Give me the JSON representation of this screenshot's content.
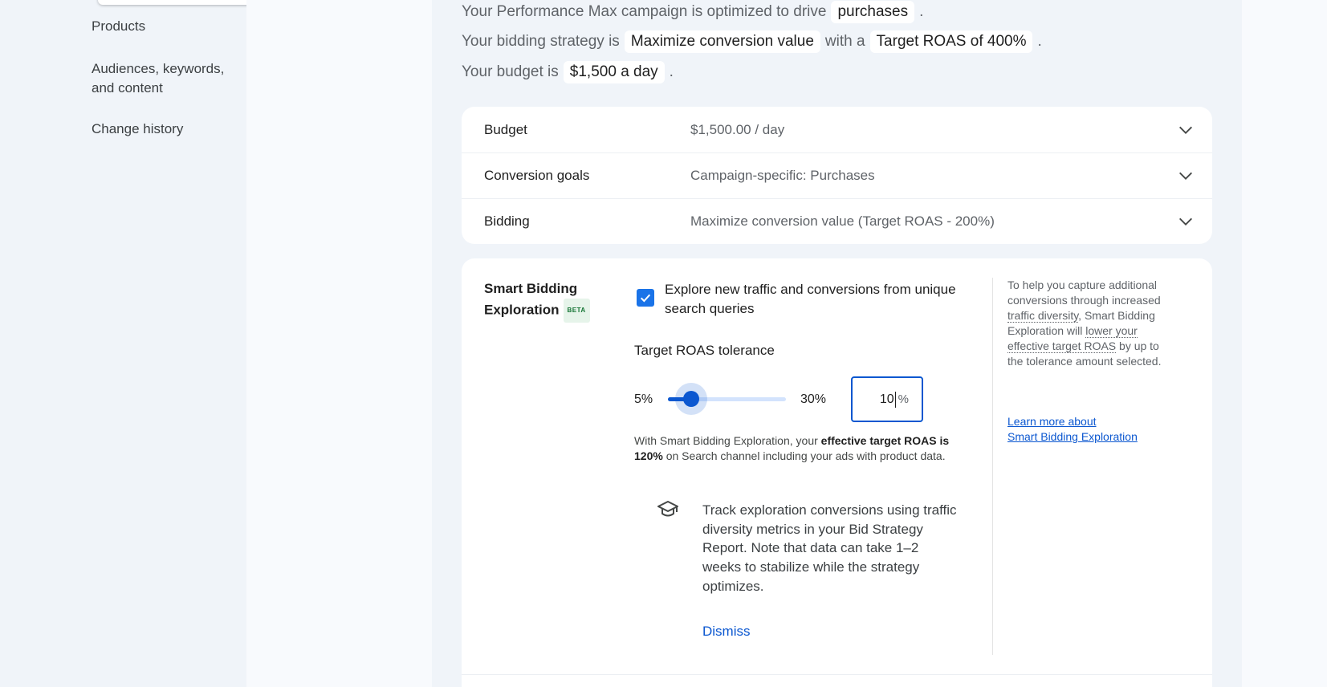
{
  "nav": {
    "items": [
      {
        "label": "Products"
      },
      {
        "label": "Audiences, keywords, and content"
      },
      {
        "label": "Change history"
      }
    ]
  },
  "summary": {
    "line1_prefix": "Your Performance Max campaign is optimized to drive",
    "line1_chip": "purchases",
    "line2_prefix": "Your bidding strategy is",
    "line2_chip1": "Maximize conversion value",
    "line2_mid": "with a",
    "line2_chip2": "Target ROAS of 400%",
    "line3_prefix": "Your budget is",
    "line3_chip": "$1,500 a day",
    "period": "."
  },
  "settings": {
    "rows": [
      {
        "label": "Budget",
        "value": "$1,500.00 / day"
      },
      {
        "label": "Conversion goals",
        "value": "Campaign-specific: Purchases"
      },
      {
        "label": "Bidding",
        "value": "Maximize conversion value (Target ROAS - 200%)"
      }
    ]
  },
  "sbe": {
    "title_line1": "Smart Bidding",
    "title_line2": "Exploration",
    "beta": "BETA",
    "checkbox_label": "Explore new traffic and conversions from unique search queries",
    "checked": true,
    "tolerance_title": "Target ROAS tolerance",
    "min_label": "5%",
    "max_label": "30%",
    "slider": {
      "min": 5,
      "max": 30,
      "value": 10
    },
    "input_value": "10",
    "input_unit": "%",
    "explain_1": "With Smart Bidding Exploration, your ",
    "explain_bold": "effective target ROAS is 120%",
    "explain_2": " on Search channel including your ads with product data.",
    "tip": "Track exploration conversions using traffic diversity metrics in your Bid Strategy Report. Note that data can take 1–2 weeks to stabilize while the strategy optimizes.",
    "dismiss": "Dismiss",
    "help_1": "To help you capture additional conversions through increased ",
    "help_link1": "traffic diversity",
    "help_2": ", Smart Bidding Exploration will ",
    "help_link2": "lower your effective target ROAS",
    "help_3": " by up to the tolerance amount selected.",
    "learn_line1": "Learn more about",
    "learn_line2": "Smart Bidding Exploration"
  },
  "colors": {
    "accent": "#0b57d0",
    "background": "#f0f4f9",
    "beta_text": "#137333"
  }
}
